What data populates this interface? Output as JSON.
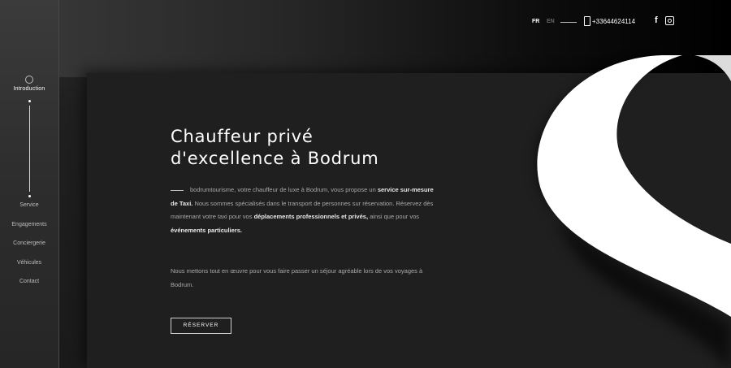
{
  "sidebar": {
    "items": [
      {
        "label": "Introduction"
      },
      {
        "label": "Service"
      },
      {
        "label": "Engagements"
      },
      {
        "label": "Conciergerie"
      },
      {
        "label": "Véhicules"
      },
      {
        "label": "Contact"
      }
    ]
  },
  "header": {
    "lang_fr": "FR",
    "lang_en": "EN",
    "phone": "+33644624114"
  },
  "hero": {
    "title_line1": "Chauffeur privé",
    "title_line2": "d'excellence à Bodrum",
    "p1_a": "bodrumtourisme, votre chauffeur de luxe à Bodrum, vous propose un",
    "p1_b": "service sur-mesure de Taxi.",
    "p1_c": " Nous sommes spécialisés dans le transport de personnes sur réservation. Réservez dès maintenant votre taxi pour vos ",
    "p1_d": "déplacements professionnels et privés,",
    "p1_e": " ainsi que pour vos ",
    "p1_f": "événements particuliers.",
    "p2": "Nous mettons tout en œuvre pour vous faire passer un séjour agréable lors de vos voyages à Bodrum.",
    "reserve_label": "RÉSERVER"
  },
  "colors": {
    "accent": "#ffffff",
    "background": "#1f1f1f"
  }
}
